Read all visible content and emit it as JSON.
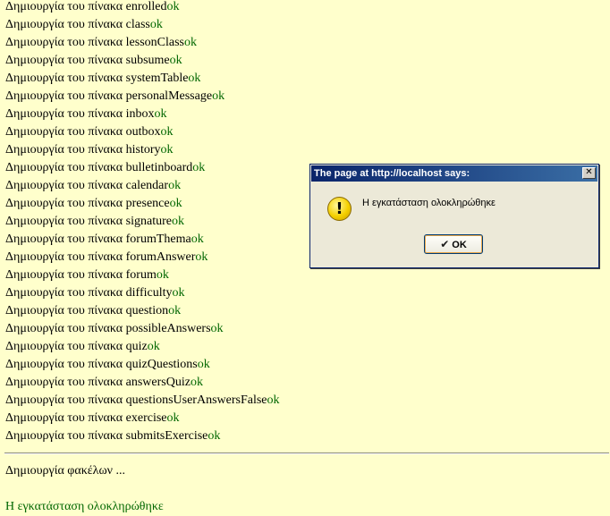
{
  "log": {
    "prefix": "Δημιουργία του πίνακα ",
    "status": "ok",
    "tables": [
      "enrolled",
      "class",
      "lessonClass",
      "subsume",
      "systemTable",
      "personalMessage",
      "inbox",
      "outbox",
      "history",
      "bulletinboard",
      "calendar",
      "presence",
      "signature",
      "forumThema",
      "forumAnswer",
      "forum",
      "difficulty",
      "question",
      "possibleAnswers",
      "quiz",
      "quizQuestions",
      "answersQuiz",
      "questionsUserAnswersFalse",
      "exercise",
      "submitsExercise"
    ]
  },
  "folders_text": "Δημιουργία φακέλων ...",
  "done_text": "Η εγκατάσταση ολοκληρώθηκε",
  "dialog": {
    "title": "The page at http://localhost says:",
    "close_glyph": "✕",
    "icon_glyph": "!",
    "message": "Η εγκατάσταση ολοκληρώθηκε",
    "ok_check": "✔",
    "ok_label": "OK"
  }
}
